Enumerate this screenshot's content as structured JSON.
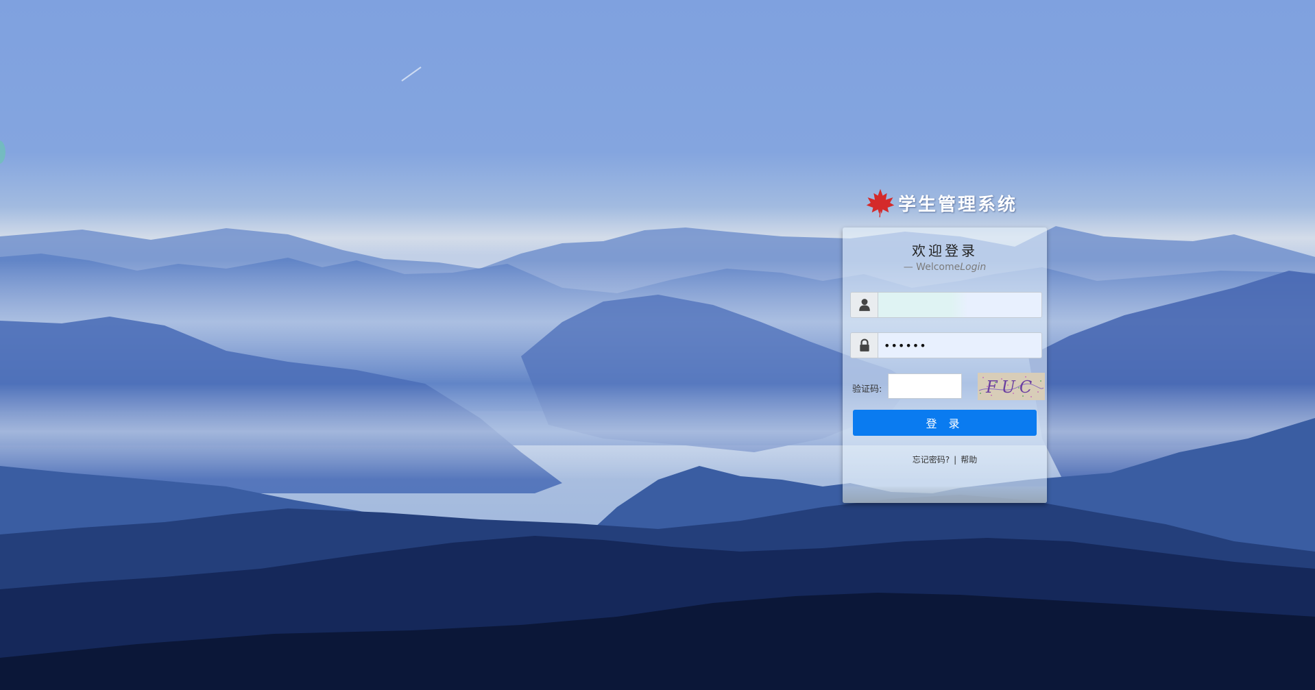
{
  "brand": {
    "title": "学生管理系统",
    "logo_icon": "maple-leaf-icon",
    "logo_color": "#d42a2a"
  },
  "login": {
    "title": "欢迎登录",
    "subtitle_prefix": "— Welcome",
    "subtitle_em": "Login",
    "username": {
      "icon": "user-icon",
      "value": "",
      "placeholder": ""
    },
    "password": {
      "icon": "lock-icon",
      "value": "••••••",
      "placeholder": ""
    },
    "captcha": {
      "label": "验证码:",
      "value": "",
      "image_text": "FUC"
    },
    "submit_label": "登 录",
    "forgot_label": "忘记密码?",
    "separator": "|",
    "help_label": "帮助"
  },
  "colors": {
    "accent": "#0a7bf0",
    "card_bg": "rgba(228,240,250,0.58)"
  }
}
